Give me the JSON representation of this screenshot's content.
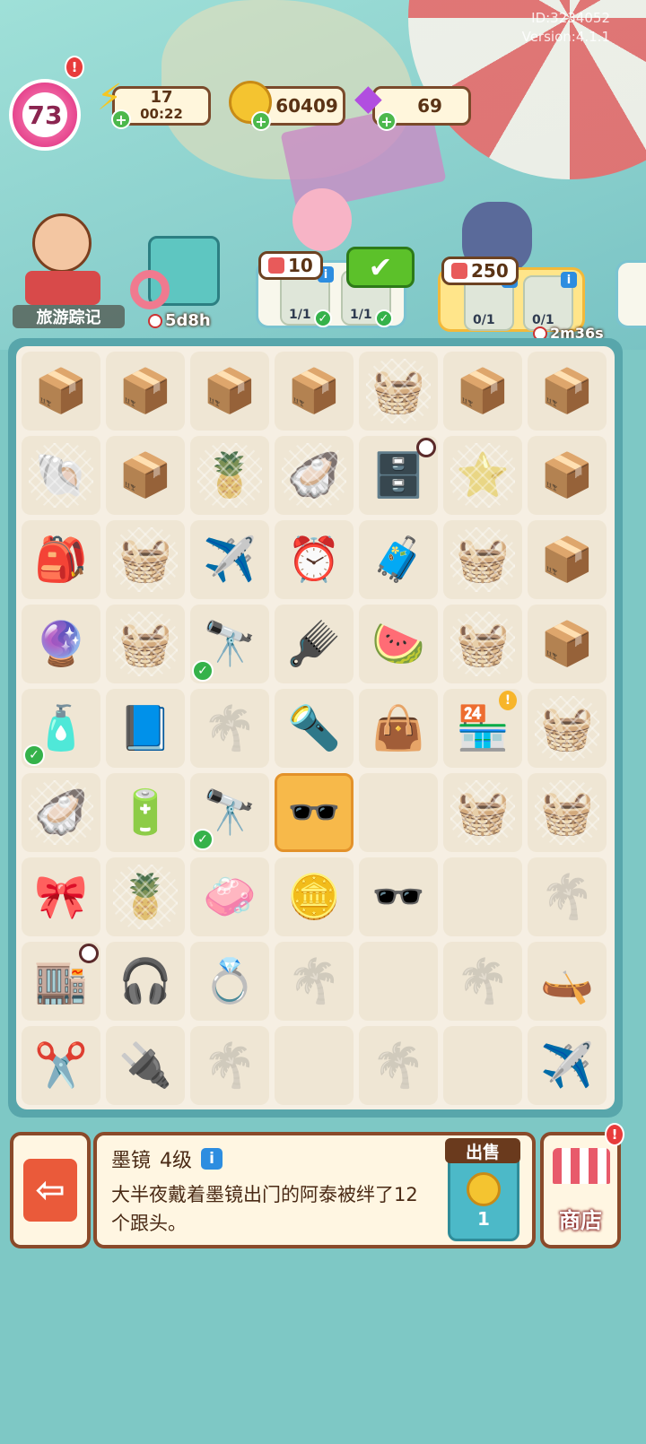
{
  "build": {
    "id": "ID:3234052",
    "version": "Version:4.1.1"
  },
  "header": {
    "level": "73",
    "energy": {
      "value": "17",
      "timer": "00:22",
      "icon": "lightning-icon"
    },
    "coins": {
      "value": "60409",
      "icon": "coin-icon"
    },
    "gems": {
      "value": "69",
      "icon": "gem-icon"
    }
  },
  "event_panel": {
    "label": "旅游踪记"
  },
  "suitcase_event": {
    "timer": "5d8h"
  },
  "orders": [
    {
      "likes": "10",
      "items": [
        {
          "count": "1/1",
          "done": true
        },
        {
          "count": "1/1",
          "done": true
        }
      ],
      "confirm_icon": "checkmark-icon"
    },
    {
      "likes": "250",
      "items": [
        {
          "count": "0/1"
        },
        {
          "count": "0/1"
        }
      ],
      "timer": "2m36s"
    }
  ],
  "board": {
    "grid": [
      [
        {
          "t": "box",
          "i": "📦"
        },
        {
          "t": "box",
          "i": "📦"
        },
        {
          "t": "box",
          "i": "📦"
        },
        {
          "t": "box",
          "i": "📦"
        },
        {
          "t": "web",
          "i": "🧺"
        },
        {
          "t": "box",
          "i": "📦"
        },
        {
          "t": "box",
          "i": "📦"
        }
      ],
      [
        {
          "t": "web",
          "i": "🐚"
        },
        {
          "t": "box",
          "i": "📦"
        },
        {
          "t": "web",
          "i": "🍍"
        },
        {
          "t": "web",
          "i": "🦪"
        },
        {
          "t": "item",
          "i": "🗄️",
          "clock": true
        },
        {
          "t": "web",
          "i": "⭐"
        },
        {
          "t": "box",
          "i": "📦"
        }
      ],
      [
        {
          "t": "item",
          "i": "🎒"
        },
        {
          "t": "web",
          "i": "🧺"
        },
        {
          "t": "item",
          "i": "✈️"
        },
        {
          "t": "item",
          "i": "⏰"
        },
        {
          "t": "item",
          "i": "🧳"
        },
        {
          "t": "web",
          "i": "🧺"
        },
        {
          "t": "box",
          "i": "📦"
        }
      ],
      [
        {
          "t": "item",
          "i": "🔮"
        },
        {
          "t": "web",
          "i": "🧺"
        },
        {
          "t": "item",
          "i": "🔭",
          "check": true
        },
        {
          "t": "item",
          "i": "🪮"
        },
        {
          "t": "item",
          "i": "🍉"
        },
        {
          "t": "web",
          "i": "🧺"
        },
        {
          "t": "box",
          "i": "📦"
        }
      ],
      [
        {
          "t": "item",
          "i": "🧴",
          "check": true
        },
        {
          "t": "item",
          "i": "📘"
        },
        {
          "t": "empty",
          "i": "🌴"
        },
        {
          "t": "item",
          "i": "🔦"
        },
        {
          "t": "item",
          "i": "👜"
        },
        {
          "t": "item",
          "i": "🏪",
          "excl": true
        },
        {
          "t": "web",
          "i": "🧺"
        }
      ],
      [
        {
          "t": "web",
          "i": "🦪"
        },
        {
          "t": "item",
          "i": "🔋"
        },
        {
          "t": "item",
          "i": "🔭",
          "check": true
        },
        {
          "t": "sel",
          "i": "🕶️"
        },
        {
          "t": "blank",
          "i": ""
        },
        {
          "t": "web",
          "i": "🧺"
        },
        {
          "t": "web",
          "i": "🧺"
        }
      ],
      [
        {
          "t": "item",
          "i": "🎀"
        },
        {
          "t": "web",
          "i": "🍍"
        },
        {
          "t": "item",
          "i": "🧼"
        },
        {
          "t": "item",
          "i": "🪙"
        },
        {
          "t": "item",
          "i": "🕶️"
        },
        {
          "t": "blank",
          "i": ""
        },
        {
          "t": "empty",
          "i": "🌴"
        }
      ],
      [
        {
          "t": "item",
          "i": "🏬",
          "clock": true
        },
        {
          "t": "item",
          "i": "🎧"
        },
        {
          "t": "item",
          "i": "💍"
        },
        {
          "t": "empty",
          "i": "🌴"
        },
        {
          "t": "blank",
          "i": ""
        },
        {
          "t": "empty",
          "i": "🌴"
        },
        {
          "t": "item",
          "i": "🛶"
        }
      ],
      [
        {
          "t": "item",
          "i": "✂️"
        },
        {
          "t": "item",
          "i": "🔌"
        },
        {
          "t": "empty",
          "i": "🌴"
        },
        {
          "t": "blank",
          "i": ""
        },
        {
          "t": "empty",
          "i": "🌴"
        },
        {
          "t": "blank",
          "i": ""
        },
        {
          "t": "item",
          "i": "✈️"
        }
      ]
    ]
  },
  "selected_item": {
    "name": "墨镜",
    "level": "4级",
    "description": "大半夜戴着墨镜出门的阿泰被绊了12个跟头。",
    "sell_label": "出售",
    "sell_price": "1"
  },
  "shop": {
    "label": "商店",
    "alert": "!"
  },
  "colors": {
    "board_bg": "#58a6ab",
    "panel_bg": "#fff6e2",
    "accent_border": "#8a4a2a"
  }
}
